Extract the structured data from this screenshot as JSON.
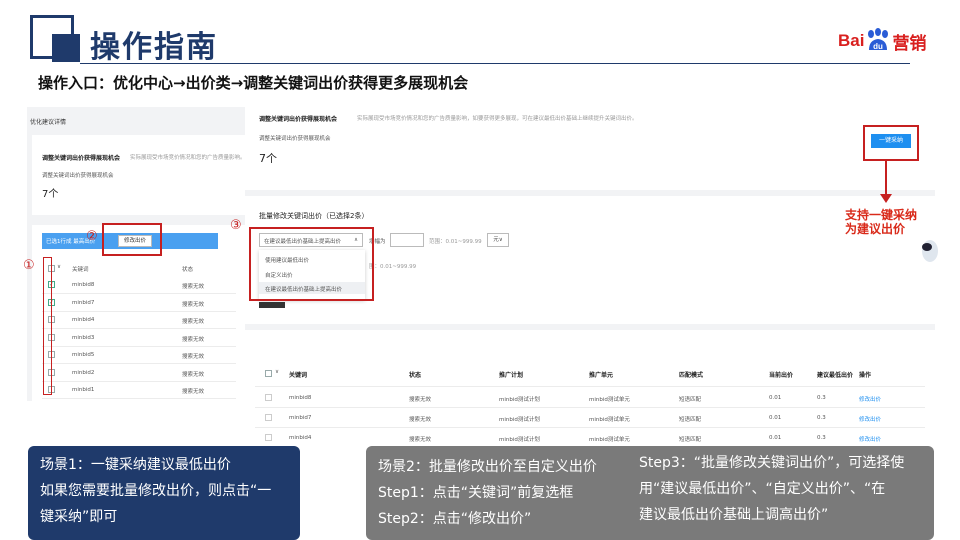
{
  "header": {
    "title": "操作指南",
    "logo_left": "Bai",
    "logo_du": "du",
    "logo_right": "营销",
    "subtitle": "操作入口：优化中心→出价类→调整关键词出价获得更多展现机会"
  },
  "left_panel": {
    "heading": "优化建议详情",
    "card_title": "调整关键词出价获得展现机会",
    "card_desc": "实际展现受市场竞价情况和您的广告质量影响。跟",
    "count_label": "调整关键词出价获得展现机会",
    "count_value": "7个",
    "selected_text": "已选1行成 最高出价",
    "batch_button": "修改出价",
    "col_keyword": "关键词",
    "col_status": "状态",
    "rows": [
      {
        "keyword": "minbid8",
        "status": "搜索无效",
        "checked": true
      },
      {
        "keyword": "minbid7",
        "status": "搜索无效",
        "checked": true
      },
      {
        "keyword": "minbid4",
        "status": "搜索无效",
        "checked": false
      },
      {
        "keyword": "minbid3",
        "status": "搜索无效",
        "checked": false
      },
      {
        "keyword": "minbid5",
        "status": "搜索无效",
        "checked": false
      },
      {
        "keyword": "minbid2",
        "status": "搜索无效",
        "checked": false
      },
      {
        "keyword": "minbid1",
        "status": "搜索无效",
        "checked": false
      }
    ]
  },
  "right_panel": {
    "card_title": "调整关键词出价获得展现机会",
    "card_desc": "实际展现受市场竞价情况和您的广告质量影响，如要获得更多展现，可在建议最低出价基础上继续提升关键词出价。",
    "count_label": "调整关键词出价获得展现机会",
    "count_value": "7个",
    "accept_button": "一键采纳",
    "batch_title": "批量修改关键词出价（已选择2条）",
    "select_value": "在建议最低出价基础上提高出价",
    "amount_label": "增幅为",
    "range_text": "范围：0.01~999.99",
    "unit": "元∨",
    "range_text2": "围：0.01~999.99",
    "options": [
      "使用建议最低出价",
      "自定义出价",
      "在建议最低出价基础上提高出价"
    ],
    "columns": [
      "关键词",
      "状态",
      "推广计划",
      "推广单元",
      "匹配模式",
      "当前出价",
      "建议最低出价",
      "操作"
    ],
    "rows": [
      {
        "keyword": "minbid8",
        "status": "搜索无效",
        "plan": "minbid测试计划",
        "unit": "minbid测试单元",
        "match": "短语匹配",
        "current": "0.01",
        "suggest": "0.3",
        "op": "修改出价"
      },
      {
        "keyword": "minbid7",
        "status": "搜索无效",
        "plan": "minbid测试计划",
        "unit": "minbid测试单元",
        "match": "短语匹配",
        "current": "0.01",
        "suggest": "0.3",
        "op": "修改出价"
      },
      {
        "keyword": "minbid4",
        "status": "搜索无效",
        "plan": "minbid测试计划",
        "unit": "minbid测试单元",
        "match": "短语匹配",
        "current": "0.01",
        "suggest": "0.3",
        "op": "修改出价"
      }
    ]
  },
  "annotations": {
    "m1": "①",
    "m2": "②",
    "m3": "③",
    "side_note_1": "支持一键采纳",
    "side_note_2": "为建议出价"
  },
  "scenes": {
    "s1_line1": "场景1：一键采纳建议最低出价",
    "s1_line2": "如果您需要批量修改出价，则点击“一",
    "s1_line3": "键采纳”即可",
    "s2_line1": "场景2：批量修改出价至自定义出价",
    "s2_line2": "Step1：点击“关键词”前复选框",
    "s2_line3": "Step2：点击“修改出价”",
    "s3_line1": "Step3：“批量修改关键词出价”，可选择使",
    "s3_line2": "用“建议最低出价”、“自定义出价”、“在",
    "s3_line3": "建议最低出价基础上调高出价”"
  },
  "colors": {
    "navy": "#1f3a6b",
    "red": "#c62020",
    "blue": "#1e8ff0",
    "gray_box": "#7a7a7a"
  }
}
